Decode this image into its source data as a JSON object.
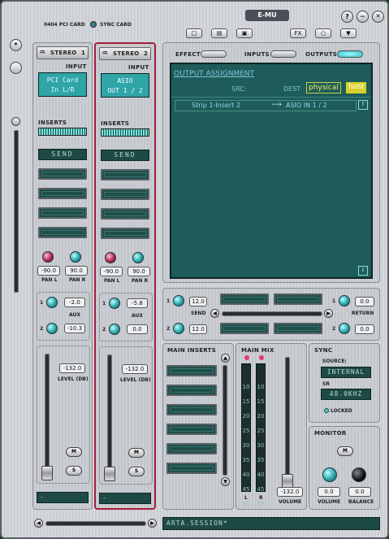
{
  "header": {
    "card1": "0404 PCI CARD",
    "card2": "SYNC CARD",
    "brand": "E-MU",
    "help": "?",
    "minimize": "—",
    "close": "✕",
    "fx": "FX",
    "toolbar_icons": [
      "new-icon",
      "open-icon",
      "save-icon"
    ]
  },
  "strips": [
    {
      "title": "STEREO",
      "number": "1",
      "input_label": "INPUT",
      "input_line1": "PCI Card",
      "input_line2": "In L/R",
      "inserts_label": "INSERTS",
      "send_label": "SEND",
      "pan_l": "-90.0",
      "pan_r": "90.0",
      "pan_l_label": "PAN L",
      "pan_r_label": "PAN R",
      "aux_label": "AUX",
      "aux1": "-2.0",
      "aux2": "-10.3",
      "level": "-132.0",
      "level_label": "LEVEL (DB)",
      "mute": "M",
      "solo": "S",
      "name": "-"
    },
    {
      "title": "STEREO",
      "number": "2",
      "input_label": "INPUT",
      "input_line1": "ASIO",
      "input_line2": "OUT 1 / 2",
      "inserts_label": "INSERTS",
      "send_label": "SEND",
      "pan_l": "-90.0",
      "pan_r": "90.0",
      "pan_l_label": "PAN L",
      "pan_r_label": "PAN R",
      "aux_label": "AUX",
      "aux1": "-5.8",
      "aux2": "0.0",
      "level": "-132.0",
      "level_label": "LEVEL (DB)",
      "mute": "M",
      "solo": "S",
      "name": "-"
    }
  ],
  "tabs": {
    "effect": "EFFECT",
    "inputs": "INPUTS",
    "outputs": "OUTPUTS"
  },
  "output_assignment": {
    "title": "OUTPUT ASSIGNMENT",
    "src_label": "SRC:",
    "dest_label": "DEST",
    "physical": "physical",
    "host": "host",
    "row_src": "Strip 1-Insert 2",
    "row_dest": "ASIO IN 1 / 2"
  },
  "send_return": {
    "send_label": "SEND",
    "return_label": "RETURN",
    "send1": "12.0",
    "send2": "12.0",
    "return1": "0.0",
    "return2": "0.0"
  },
  "main_inserts": {
    "label": "MAIN INSERTS"
  },
  "main_mix": {
    "label": "MAIN MIX",
    "scale": [
      "10",
      "15",
      "20",
      "25",
      "30",
      "35",
      "40",
      "45",
      "50"
    ],
    "l": "L",
    "r": "R",
    "volume": "-132.0",
    "volume_label": "VOLUME"
  },
  "sync": {
    "label": "SYNC",
    "source_label": "SOURCE:",
    "source": "INTERNAL",
    "sr_label": "SR",
    "sr": "48.0KHZ",
    "locked": "LOCKED"
  },
  "monitor": {
    "label": "MONITOR",
    "mute": "M",
    "volume": "0.0",
    "balance": "0.0",
    "volume_label": "VOLUME",
    "balance_label": "BALANCE"
  },
  "session": {
    "name": "ARTA.SESSION*"
  },
  "side": {
    "star": "*"
  }
}
